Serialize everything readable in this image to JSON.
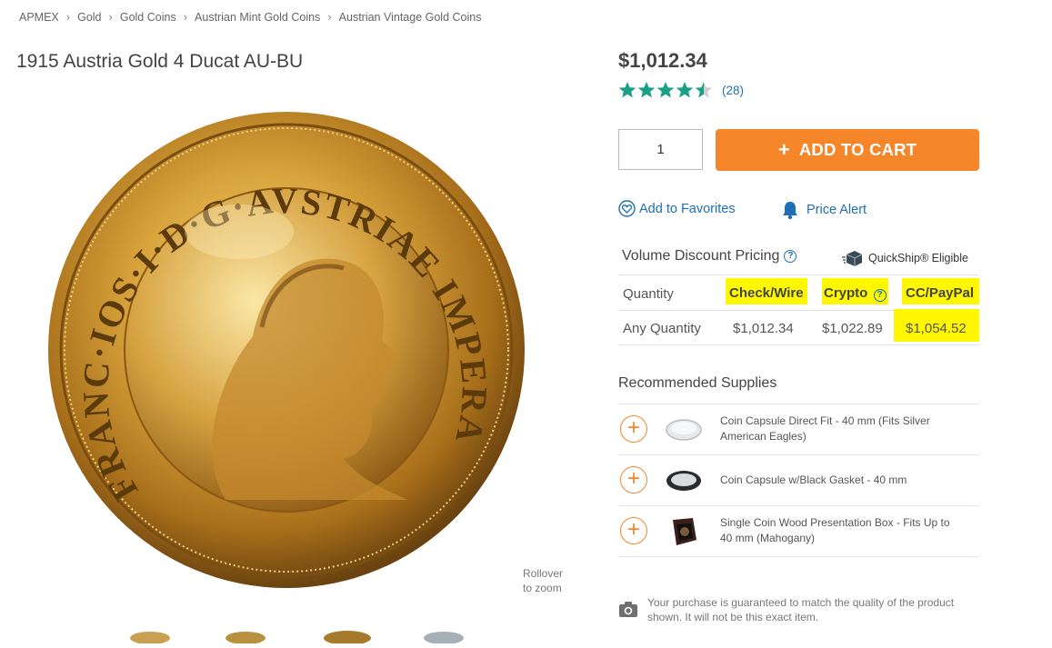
{
  "breadcrumb": [
    "APMEX",
    "Gold",
    "Gold Coins",
    "Austrian Mint Gold Coins",
    "Austrian Vintage Gold Coins"
  ],
  "product": {
    "title": "1915 Austria Gold 4 Ducat AU-BU",
    "price": "$1,012.34",
    "rating_stars": 4.5,
    "rating_count": "(28)",
    "zoom_note_line1": "Rollover",
    "zoom_note_line2": "to zoom",
    "coin_legend": "FRANC·IOS·I·D·G·AVSTRIAE IMPERATOR"
  },
  "purchase": {
    "quantity": "1",
    "add_to_cart": "ADD TO CART",
    "add_to_favorites": "Add to Favorites",
    "price_alert": "Price Alert"
  },
  "pricing": {
    "title": "Volume Discount Pricing",
    "quickship": "QuickShip® Eligible",
    "headers": [
      "Quantity",
      "Check/Wire",
      "Crypto",
      "CC/PayPal"
    ],
    "rows": [
      [
        "Any Quantity",
        "$1,012.34",
        "$1,022.89",
        "$1,054.52"
      ]
    ]
  },
  "supplies": {
    "title": "Recommended Supplies",
    "items": [
      {
        "name": "Coin Capsule Direct Fit - 40 mm (Fits Silver American Eagles)"
      },
      {
        "name": "Coin Capsule w/Black Gasket - 40 mm"
      },
      {
        "name": "Single Coin Wood Presentation Box - Fits Up to 40 mm (Mahogany)"
      }
    ]
  },
  "guarantee": "Your purchase is guaranteed to match the quality of the product shown. It will not be this exact item.",
  "colors": {
    "accent_orange": "#f5862a",
    "link_blue": "#1d6fb8",
    "star_green": "#1aa084",
    "highlight_yellow": "#fff700"
  }
}
